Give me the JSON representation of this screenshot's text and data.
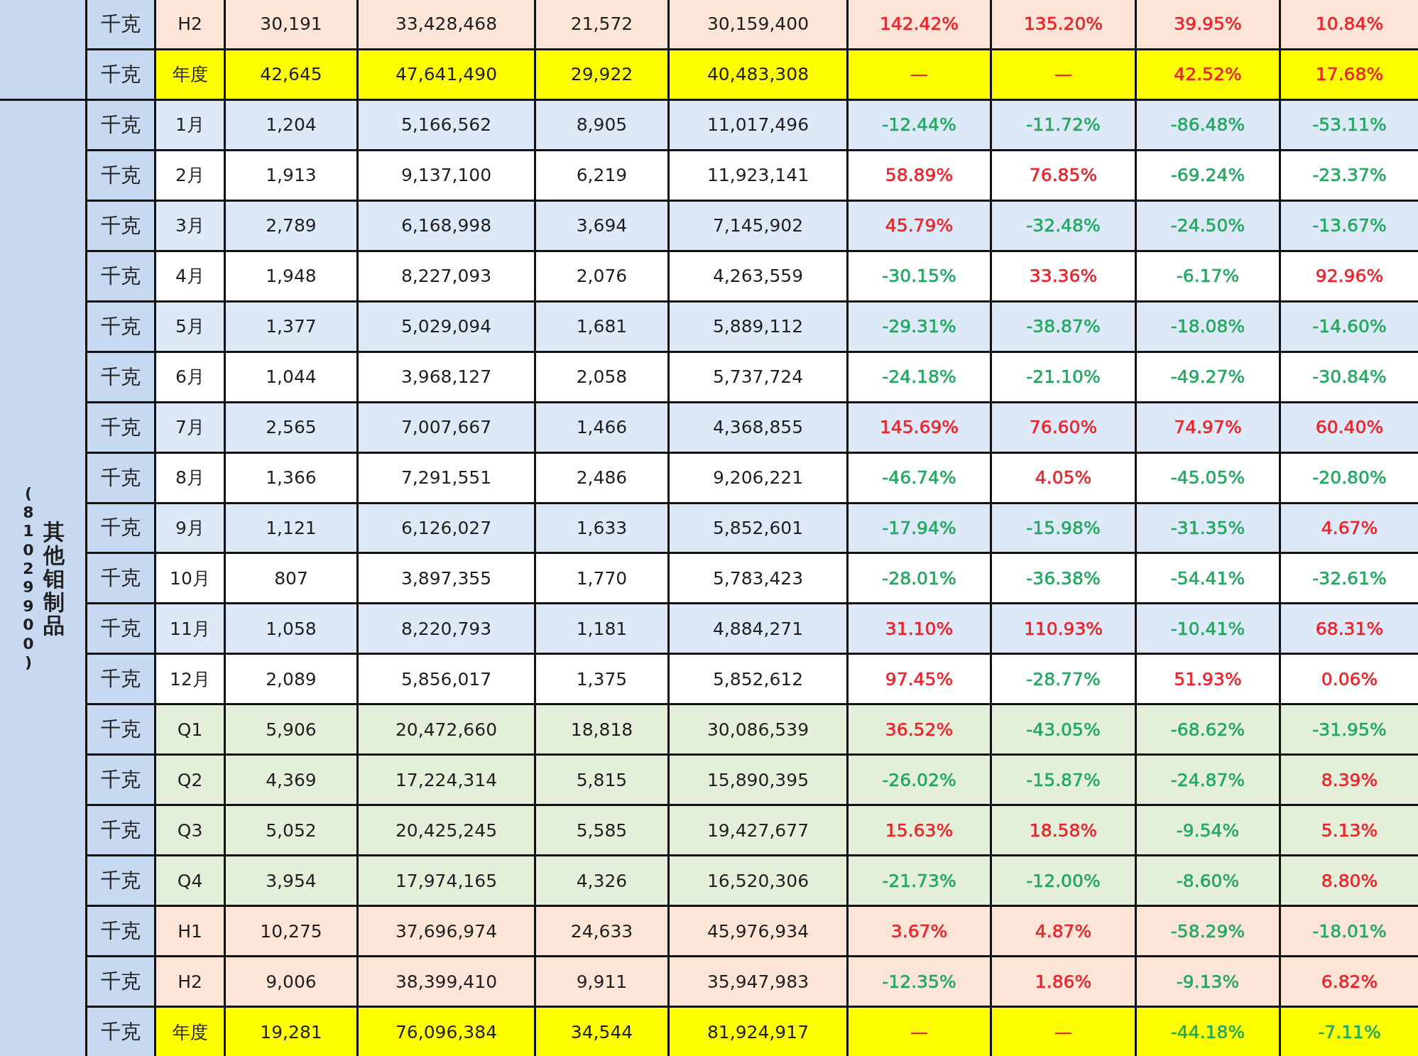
{
  "groups": [
    {
      "rows": [
        {
          "kind": "half",
          "unit": "千克",
          "period": "H2",
          "values": [
            "30,191",
            "33,428,468",
            "21,572",
            "30,159,400"
          ],
          "changes": [
            {
              "value": "142.42%",
              "color": "#e8242c"
            },
            {
              "value": "135.20%",
              "color": "#e8242c"
            },
            {
              "value": "39.95%",
              "color": "#e8242c"
            },
            {
              "value": "10.84%",
              "color": "#e8242c"
            }
          ]
        },
        {
          "kind": "year",
          "unit": "千克",
          "period": "年度",
          "values": [
            "42,645",
            "47,641,490",
            "29,922",
            "40,483,308"
          ],
          "changes": [
            {
              "value": "—",
              "color": "#e8242c"
            },
            {
              "value": "—",
              "color": "#e8242c"
            },
            {
              "value": "42.52%",
              "color": "#e8242c"
            },
            {
              "value": "17.68%",
              "color": "#e8242c"
            }
          ]
        }
      ]
    },
    {
      "code": "(81029900)",
      "label": "其他钼制品",
      "rows": [
        {
          "kind": "month_shaded",
          "unit": "千克",
          "period": "1月",
          "values": [
            "1,204",
            "5,166,562",
            "8,905",
            "11,017,496"
          ],
          "changes": [
            {
              "value": "-12.44%",
              "color": "#22a862"
            },
            {
              "value": "-11.72%",
              "color": "#22a862"
            },
            {
              "value": "-86.48%",
              "color": "#22a862"
            },
            {
              "value": "-53.11%",
              "color": "#22a862"
            }
          ]
        },
        {
          "kind": "month",
          "unit": "千克",
          "period": "2月",
          "values": [
            "1,913",
            "9,137,100",
            "6,219",
            "11,923,141"
          ],
          "changes": [
            {
              "value": "58.89%",
              "color": "#e8242c"
            },
            {
              "value": "76.85%",
              "color": "#e8242c"
            },
            {
              "value": "-69.24%",
              "color": "#22a862"
            },
            {
              "value": "-23.37%",
              "color": "#22a862"
            }
          ]
        },
        {
          "kind": "month_shaded",
          "unit": "千克",
          "period": "3月",
          "values": [
            "2,789",
            "6,168,998",
            "3,694",
            "7,145,902"
          ],
          "changes": [
            {
              "value": "45.79%",
              "color": "#e8242c"
            },
            {
              "value": "-32.48%",
              "color": "#22a862"
            },
            {
              "value": "-24.50%",
              "color": "#22a862"
            },
            {
              "value": "-13.67%",
              "color": "#22a862"
            }
          ]
        },
        {
          "kind": "month",
          "unit": "千克",
          "period": "4月",
          "values": [
            "1,948",
            "8,227,093",
            "2,076",
            "4,263,559"
          ],
          "changes": [
            {
              "value": "-30.15%",
              "color": "#22a862"
            },
            {
              "value": "33.36%",
              "color": "#e8242c"
            },
            {
              "value": "-6.17%",
              "color": "#22a862"
            },
            {
              "value": "92.96%",
              "color": "#e8242c"
            }
          ]
        },
        {
          "kind": "month_shaded",
          "unit": "千克",
          "period": "5月",
          "values": [
            "1,377",
            "5,029,094",
            "1,681",
            "5,889,112"
          ],
          "changes": [
            {
              "value": "-29.31%",
              "color": "#22a862"
            },
            {
              "value": "-38.87%",
              "color": "#22a862"
            },
            {
              "value": "-18.08%",
              "color": "#22a862"
            },
            {
              "value": "-14.60%",
              "color": "#22a862"
            }
          ]
        },
        {
          "kind": "month",
          "unit": "千克",
          "period": "6月",
          "values": [
            "1,044",
            "3,968,127",
            "2,058",
            "5,737,724"
          ],
          "changes": [
            {
              "value": "-24.18%",
              "color": "#22a862"
            },
            {
              "value": "-21.10%",
              "color": "#22a862"
            },
            {
              "value": "-49.27%",
              "color": "#22a862"
            },
            {
              "value": "-30.84%",
              "color": "#22a862"
            }
          ]
        },
        {
          "kind": "month_shaded",
          "unit": "千克",
          "period": "7月",
          "values": [
            "2,565",
            "7,007,667",
            "1,466",
            "4,368,855"
          ],
          "changes": [
            {
              "value": "145.69%",
              "color": "#e8242c"
            },
            {
              "value": "76.60%",
              "color": "#e8242c"
            },
            {
              "value": "74.97%",
              "color": "#e8242c"
            },
            {
              "value": "60.40%",
              "color": "#e8242c"
            }
          ]
        },
        {
          "kind": "month",
          "unit": "千克",
          "period": "8月",
          "values": [
            "1,366",
            "7,291,551",
            "2,486",
            "9,206,221"
          ],
          "changes": [
            {
              "value": "-46.74%",
              "color": "#22a862"
            },
            {
              "value": "4.05%",
              "color": "#e8242c"
            },
            {
              "value": "-45.05%",
              "color": "#22a862"
            },
            {
              "value": "-20.80%",
              "color": "#22a862"
            }
          ]
        },
        {
          "kind": "month_shaded",
          "unit": "千克",
          "period": "9月",
          "values": [
            "1,121",
            "6,126,027",
            "1,633",
            "5,852,601"
          ],
          "changes": [
            {
              "value": "-17.94%",
              "color": "#22a862"
            },
            {
              "value": "-15.98%",
              "color": "#22a862"
            },
            {
              "value": "-31.35%",
              "color": "#22a862"
            },
            {
              "value": "4.67%",
              "color": "#e8242c"
            }
          ]
        },
        {
          "kind": "month",
          "unit": "千克",
          "period": "10月",
          "values": [
            "807",
            "3,897,355",
            "1,770",
            "5,783,423"
          ],
          "changes": [
            {
              "value": "-28.01%",
              "color": "#22a862"
            },
            {
              "value": "-36.38%",
              "color": "#22a862"
            },
            {
              "value": "-54.41%",
              "color": "#22a862"
            },
            {
              "value": "-32.61%",
              "color": "#22a862"
            }
          ]
        },
        {
          "kind": "month_shaded",
          "unit": "千克",
          "period": "11月",
          "values": [
            "1,058",
            "8,220,793",
            "1,181",
            "4,884,271"
          ],
          "changes": [
            {
              "value": "31.10%",
              "color": "#e8242c"
            },
            {
              "value": "110.93%",
              "color": "#e8242c"
            },
            {
              "value": "-10.41%",
              "color": "#22a862"
            },
            {
              "value": "68.31%",
              "color": "#e8242c"
            }
          ]
        },
        {
          "kind": "month",
          "unit": "千克",
          "period": "12月",
          "values": [
            "2,089",
            "5,856,017",
            "1,375",
            "5,852,612"
          ],
          "changes": [
            {
              "value": "97.45%",
              "color": "#e8242c"
            },
            {
              "value": "-28.77%",
              "color": "#22a862"
            },
            {
              "value": "51.93%",
              "color": "#e8242c"
            },
            {
              "value": "0.06%",
              "color": "#e8242c"
            }
          ]
        },
        {
          "kind": "quarter",
          "unit": "千克",
          "period": "Q1",
          "values": [
            "5,906",
            "20,472,660",
            "18,818",
            "30,086,539"
          ],
          "changes": [
            {
              "value": "36.52%",
              "color": "#e8242c"
            },
            {
              "value": "-43.05%",
              "color": "#22a862"
            },
            {
              "value": "-68.62%",
              "color": "#22a862"
            },
            {
              "value": "-31.95%",
              "color": "#22a862"
            }
          ]
        },
        {
          "kind": "quarter",
          "unit": "千克",
          "period": "Q2",
          "values": [
            "4,369",
            "17,224,314",
            "5,815",
            "15,890,395"
          ],
          "changes": [
            {
              "value": "-26.02%",
              "color": "#22a862"
            },
            {
              "value": "-15.87%",
              "color": "#22a862"
            },
            {
              "value": "-24.87%",
              "color": "#22a862"
            },
            {
              "value": "8.39%",
              "color": "#e8242c"
            }
          ]
        },
        {
          "kind": "quarter",
          "unit": "千克",
          "period": "Q3",
          "values": [
            "5,052",
            "20,425,245",
            "5,585",
            "19,427,677"
          ],
          "changes": [
            {
              "value": "15.63%",
              "color": "#e8242c"
            },
            {
              "value": "18.58%",
              "color": "#e8242c"
            },
            {
              "value": "-9.54%",
              "color": "#22a862"
            },
            {
              "value": "5.13%",
              "color": "#e8242c"
            }
          ]
        },
        {
          "kind": "quarter",
          "unit": "千克",
          "period": "Q4",
          "values": [
            "3,954",
            "17,974,165",
            "4,326",
            "16,520,306"
          ],
          "changes": [
            {
              "value": "-21.73%",
              "color": "#22a862"
            },
            {
              "value": "-12.00%",
              "color": "#22a862"
            },
            {
              "value": "-8.60%",
              "color": "#22a862"
            },
            {
              "value": "8.80%",
              "color": "#e8242c"
            }
          ]
        },
        {
          "kind": "half",
          "unit": "千克",
          "period": "H1",
          "values": [
            "10,275",
            "37,696,974",
            "24,633",
            "45,976,934"
          ],
          "changes": [
            {
              "value": "3.67%",
              "color": "#e8242c"
            },
            {
              "value": "4.87%",
              "color": "#e8242c"
            },
            {
              "value": "-58.29%",
              "color": "#22a862"
            },
            {
              "value": "-18.01%",
              "color": "#22a862"
            }
          ]
        },
        {
          "kind": "half",
          "unit": "千克",
          "period": "H2",
          "values": [
            "9,006",
            "38,399,410",
            "9,911",
            "35,947,983"
          ],
          "changes": [
            {
              "value": "-12.35%",
              "color": "#22a862"
            },
            {
              "value": "1.86%",
              "color": "#e8242c"
            },
            {
              "value": "-9.13%",
              "color": "#22a862"
            },
            {
              "value": "6.82%",
              "color": "#e8242c"
            }
          ]
        },
        {
          "kind": "year",
          "unit": "千克",
          "period": "年度",
          "values": [
            "19,281",
            "76,096,384",
            "34,544",
            "81,924,917"
          ],
          "changes": [
            {
              "value": "—",
              "color": "#e8242c"
            },
            {
              "value": "—",
              "color": "#e8242c"
            },
            {
              "value": "-44.18%",
              "color": "#22a862"
            },
            {
              "value": "-7.11%",
              "color": "#22a862"
            }
          ]
        }
      ]
    }
  ]
}
